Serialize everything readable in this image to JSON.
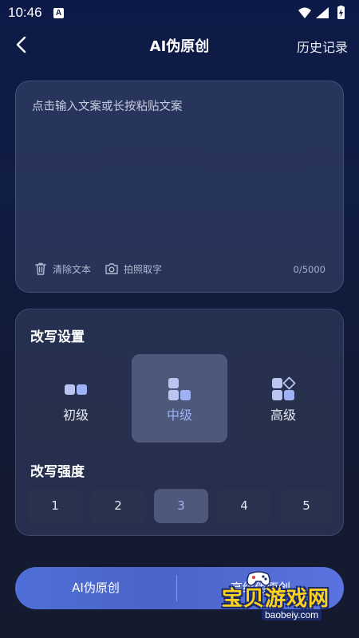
{
  "status": {
    "time": "10:46",
    "notif_letter": "A"
  },
  "header": {
    "title": "AI伪原创",
    "history": "历史记录"
  },
  "input": {
    "placeholder": "点击输入文案或长按粘贴文案",
    "clear_label": "清除文本",
    "photo_label": "拍照取字",
    "counter": "0/5000"
  },
  "settings": {
    "rewrite_title": "改写设置",
    "levels": [
      {
        "label": "初级",
        "selected": false
      },
      {
        "label": "中级",
        "selected": true
      },
      {
        "label": "高级",
        "selected": false
      }
    ],
    "strength_title": "改写强度",
    "strengths": [
      "1",
      "2",
      "3",
      "4",
      "5"
    ],
    "selected_strength": "3"
  },
  "bottom": {
    "left_label": "AI伪原创",
    "right_label": "高级伪原创"
  },
  "watermark": {
    "text": "宝贝游戏网",
    "url": "baobeiy.com"
  },
  "colors": {
    "accent": "#9fb1f5",
    "button": "#4f6fd8"
  }
}
